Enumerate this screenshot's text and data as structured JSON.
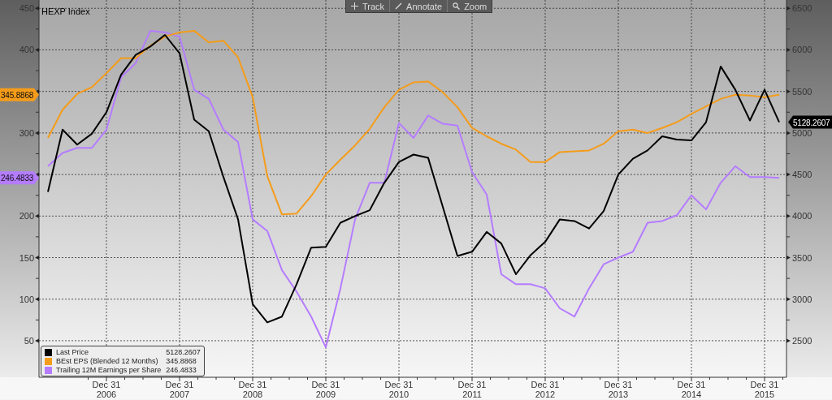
{
  "chart": {
    "toolbar": [
      {
        "kind": "track",
        "label": "Track"
      },
      {
        "kind": "annotate",
        "label": "Annotate"
      },
      {
        "kind": "zoom",
        "label": "Zoom"
      }
    ],
    "legend_values": [
      {
        "value": "5128.2607"
      },
      {
        "value": "345.8868"
      },
      {
        "value": "246.4833"
      }
    ],
    "value_tags": [
      {
        "text": "5128.2607"
      },
      {
        "text": "345.8868"
      },
      {
        "text": "246.4833"
      }
    ],
    "chart_data": {
      "type": "line",
      "title": "HEXP Index",
      "categories": [
        null,
        null,
        null,
        null,
        "Dec 31 2006",
        null,
        null,
        null,
        null,
        "Dec 31 2007",
        null,
        null,
        null,
        null,
        "Dec 31 2008",
        null,
        null,
        null,
        null,
        "Dec 31 2009",
        null,
        null,
        null,
        null,
        "Dec 31 2010",
        null,
        null,
        null,
        null,
        "Dec 31 2011",
        null,
        null,
        null,
        null,
        "Dec 31 2012",
        null,
        null,
        null,
        null,
        "Dec 31 2013",
        null,
        null,
        null,
        null,
        "Dec 31 2014",
        null,
        null,
        null,
        null,
        "Dec 31 2015",
        null
      ],
      "series": [
        {
          "name": "Last Price",
          "color": "#000000",
          "axis": "y2",
          "values": [
            4290,
            5040,
            4860,
            4990,
            5250,
            5700,
            5940,
            6040,
            6180,
            5960,
            5160,
            5020,
            4470,
            3960,
            2940,
            2720,
            2790,
            3180,
            3620,
            3630,
            3920,
            4000,
            4070,
            4400,
            4650,
            4740,
            4700,
            4110,
            3520,
            3570,
            3810,
            3670,
            3300,
            3530,
            3690,
            3960,
            3940,
            3850,
            4060,
            4500,
            4690,
            4790,
            4960,
            4920,
            4910,
            5130,
            5800,
            5520,
            5150,
            5520,
            5130
          ]
        },
        {
          "name": "BEst EPS (Blended 12 Months)",
          "color": "#f59c1a",
          "values": [
            294,
            328,
            347,
            355,
            372,
            390,
            390,
            405,
            416,
            421,
            423,
            409,
            411,
            391,
            343,
            248,
            202,
            203,
            224,
            250,
            268,
            285,
            305,
            331,
            352,
            361,
            362,
            349,
            331,
            306,
            296,
            287,
            280,
            265,
            265,
            277,
            278,
            279,
            287,
            302,
            304,
            300,
            306,
            313,
            323,
            332,
            341,
            346,
            345,
            343,
            346
          ]
        },
        {
          "name": "Trailing 12M Earnings per Share",
          "color": "#b57cff",
          "values": [
            260,
            276,
            282,
            282,
            304,
            367,
            384,
            423,
            421,
            416,
            352,
            341,
            304,
            289,
            196,
            182,
            135,
            109,
            79,
            42,
            113,
            196,
            240,
            240,
            312,
            294,
            321,
            311,
            309,
            253,
            226,
            130,
            118,
            118,
            113,
            89,
            79,
            113,
            142,
            150,
            157,
            192,
            194,
            201,
            225,
            208,
            240,
            260,
            247,
            247,
            246
          ]
        }
      ],
      "grid": true,
      "legend": true,
      "ylim": [
        6,
        460
      ],
      "y2lim": [
        2060,
        6600
      ],
      "yticks": [
        50,
        100,
        150,
        200,
        300,
        400,
        450
      ],
      "y2ticks": [
        2500,
        3000,
        3500,
        4000,
        4500,
        5000,
        5500,
        6000,
        6500
      ]
    }
  }
}
